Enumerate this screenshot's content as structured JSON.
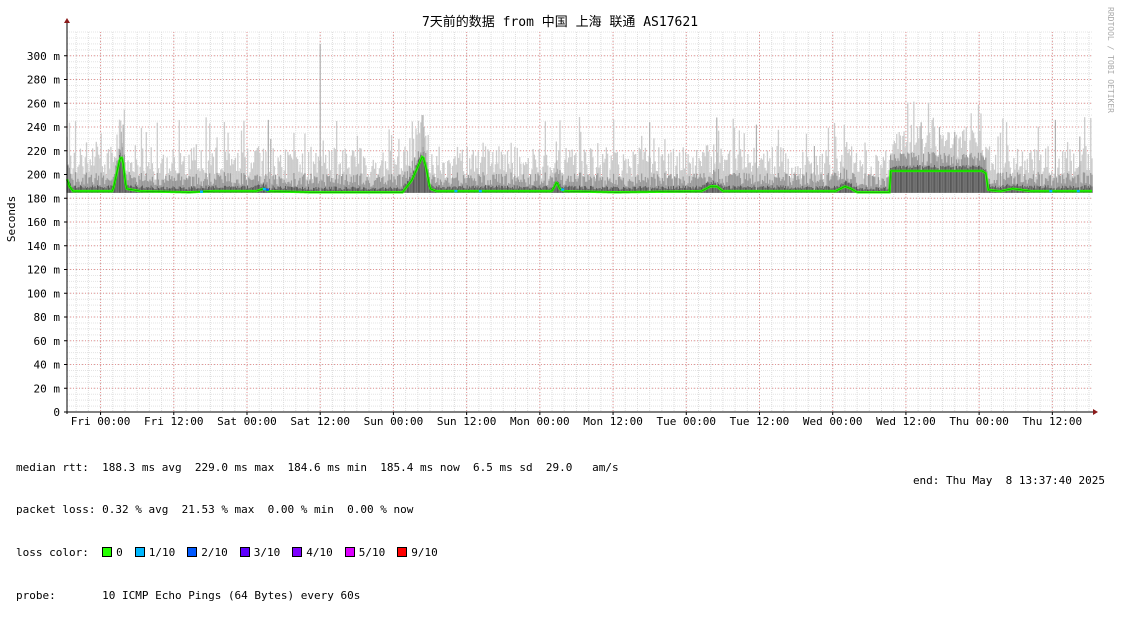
{
  "chart_data": {
    "type": "area",
    "title": "7天前的数据 from 中国 上海 联通 AS17621",
    "ylabel": "Seconds",
    "xlabel": "",
    "watermark": "RRDTOOL / TOBI OETIKER",
    "ylim": [
      0,
      320
    ],
    "yticks": [
      {
        "v": 0,
        "label": "0"
      },
      {
        "v": 20,
        "label": "20 m"
      },
      {
        "v": 40,
        "label": "40 m"
      },
      {
        "v": 60,
        "label": "60 m"
      },
      {
        "v": 80,
        "label": "80 m"
      },
      {
        "v": 100,
        "label": "100 m"
      },
      {
        "v": 120,
        "label": "120 m"
      },
      {
        "v": 140,
        "label": "140 m"
      },
      {
        "v": 160,
        "label": "160 m"
      },
      {
        "v": 180,
        "label": "180 m"
      },
      {
        "v": 200,
        "label": "200 m"
      },
      {
        "v": 220,
        "label": "220 m"
      },
      {
        "v": 240,
        "label": "240 m"
      },
      {
        "v": 260,
        "label": "260 m"
      },
      {
        "v": 280,
        "label": "280 m"
      },
      {
        "v": 300,
        "label": "300 m"
      }
    ],
    "xlim_hours": [
      0,
      168
    ],
    "xticks": [
      {
        "h": 5.5,
        "label": "Fri 00:00"
      },
      {
        "h": 17.5,
        "label": "Fri 12:00"
      },
      {
        "h": 29.5,
        "label": "Sat 00:00"
      },
      {
        "h": 41.5,
        "label": "Sat 12:00"
      },
      {
        "h": 53.5,
        "label": "Sun 00:00"
      },
      {
        "h": 65.5,
        "label": "Sun 12:00"
      },
      {
        "h": 77.5,
        "label": "Mon 00:00"
      },
      {
        "h": 89.5,
        "label": "Mon 12:00"
      },
      {
        "h": 101.5,
        "label": "Tue 00:00"
      },
      {
        "h": 113.5,
        "label": "Tue 12:00"
      },
      {
        "h": 125.5,
        "label": "Wed 00:00"
      },
      {
        "h": 137.5,
        "label": "Wed 12:00"
      },
      {
        "h": 149.5,
        "label": "Thu 00:00"
      },
      {
        "h": 161.5,
        "label": "Thu 12:00"
      }
    ],
    "median_series": {
      "name": "median rtt",
      "points": [
        [
          0,
          196
        ],
        [
          0.4,
          190
        ],
        [
          1,
          186
        ],
        [
          4,
          186
        ],
        [
          7.5,
          186
        ],
        [
          8.7,
          214
        ],
        [
          9.1,
          214
        ],
        [
          9.7,
          188
        ],
        [
          12,
          186
        ],
        [
          20,
          185
        ],
        [
          24,
          186
        ],
        [
          31,
          186
        ],
        [
          32.3,
          188
        ],
        [
          33,
          186
        ],
        [
          40,
          185
        ],
        [
          55,
          185
        ],
        [
          56.5,
          195
        ],
        [
          57.8,
          210
        ],
        [
          58.3,
          216
        ],
        [
          58.9,
          205
        ],
        [
          59.5,
          188
        ],
        [
          60.5,
          186
        ],
        [
          66,
          186
        ],
        [
          75,
          186
        ],
        [
          79.5,
          186
        ],
        [
          80.3,
          194
        ],
        [
          80.7,
          188
        ],
        [
          81.5,
          186
        ],
        [
          90,
          185
        ],
        [
          104,
          186
        ],
        [
          105.5,
          190
        ],
        [
          106.5,
          190
        ],
        [
          107.5,
          186
        ],
        [
          122,
          186
        ],
        [
          126,
          186
        ],
        [
          127.5,
          190
        ],
        [
          128.5,
          188
        ],
        [
          129.5,
          185
        ],
        [
          134.8,
          185
        ],
        [
          134.85,
          203
        ],
        [
          142,
          203
        ],
        [
          150,
          203
        ],
        [
          150.6,
          201
        ],
        [
          151,
          187
        ],
        [
          153,
          186
        ],
        [
          155,
          188
        ],
        [
          158,
          186
        ],
        [
          164,
          186
        ],
        [
          168,
          186
        ]
      ]
    },
    "smoke_spikes": [
      [
        8.9,
        236
      ],
      [
        9.2,
        242
      ],
      [
        33,
        246
      ],
      [
        33.4,
        230
      ],
      [
        41.5,
        310
      ],
      [
        58.2,
        250
      ],
      [
        58.5,
        240
      ],
      [
        80.3,
        212
      ],
      [
        95.5,
        244
      ],
      [
        106.5,
        248
      ],
      [
        113,
        242
      ],
      [
        122.5,
        224
      ],
      [
        140,
        244
      ],
      [
        143,
        240
      ],
      [
        145.5,
        236
      ],
      [
        162,
        246
      ],
      [
        166,
        232
      ]
    ],
    "min_rtt_line_ms": 184.6,
    "loss_colors": [
      {
        "label": "0",
        "color": "#26ff00"
      },
      {
        "label": "1/10",
        "color": "#00b8ff"
      },
      {
        "label": "2/10",
        "color": "#0059ff"
      },
      {
        "label": "3/10",
        "color": "#5e00ff"
      },
      {
        "label": "4/10",
        "color": "#7e00ff"
      },
      {
        "label": "5/10",
        "color": "#dd00ff"
      },
      {
        "label": "9/10",
        "color": "#ff0000"
      }
    ],
    "loss_events": [
      [
        21.8,
        "1/10"
      ],
      [
        32.1,
        "1/10"
      ],
      [
        32.6,
        "2/10"
      ],
      [
        63.5,
        "1/10"
      ],
      [
        67.5,
        "1/10"
      ],
      [
        81.0,
        "1/10"
      ],
      [
        161.0,
        "1/10"
      ],
      [
        165.5,
        "1/10"
      ]
    ]
  },
  "stats": {
    "rtt_label": "median rtt:",
    "rtt_values": "188.3 ms avg  229.0 ms max  184.6 ms min  185.4 ms now  6.5 ms sd  29.0   am/s",
    "loss_label": "packet loss:",
    "loss_values": "0.32 % avg  21.53 % max  0.00 % min  0.00 % now",
    "color_label": "loss color:",
    "probe_label": "probe:",
    "probe_value": "10 ICMP Echo Pings (64 Bytes) every 60s",
    "end_label": "end: Thu May  8 13:37:40 2025"
  }
}
